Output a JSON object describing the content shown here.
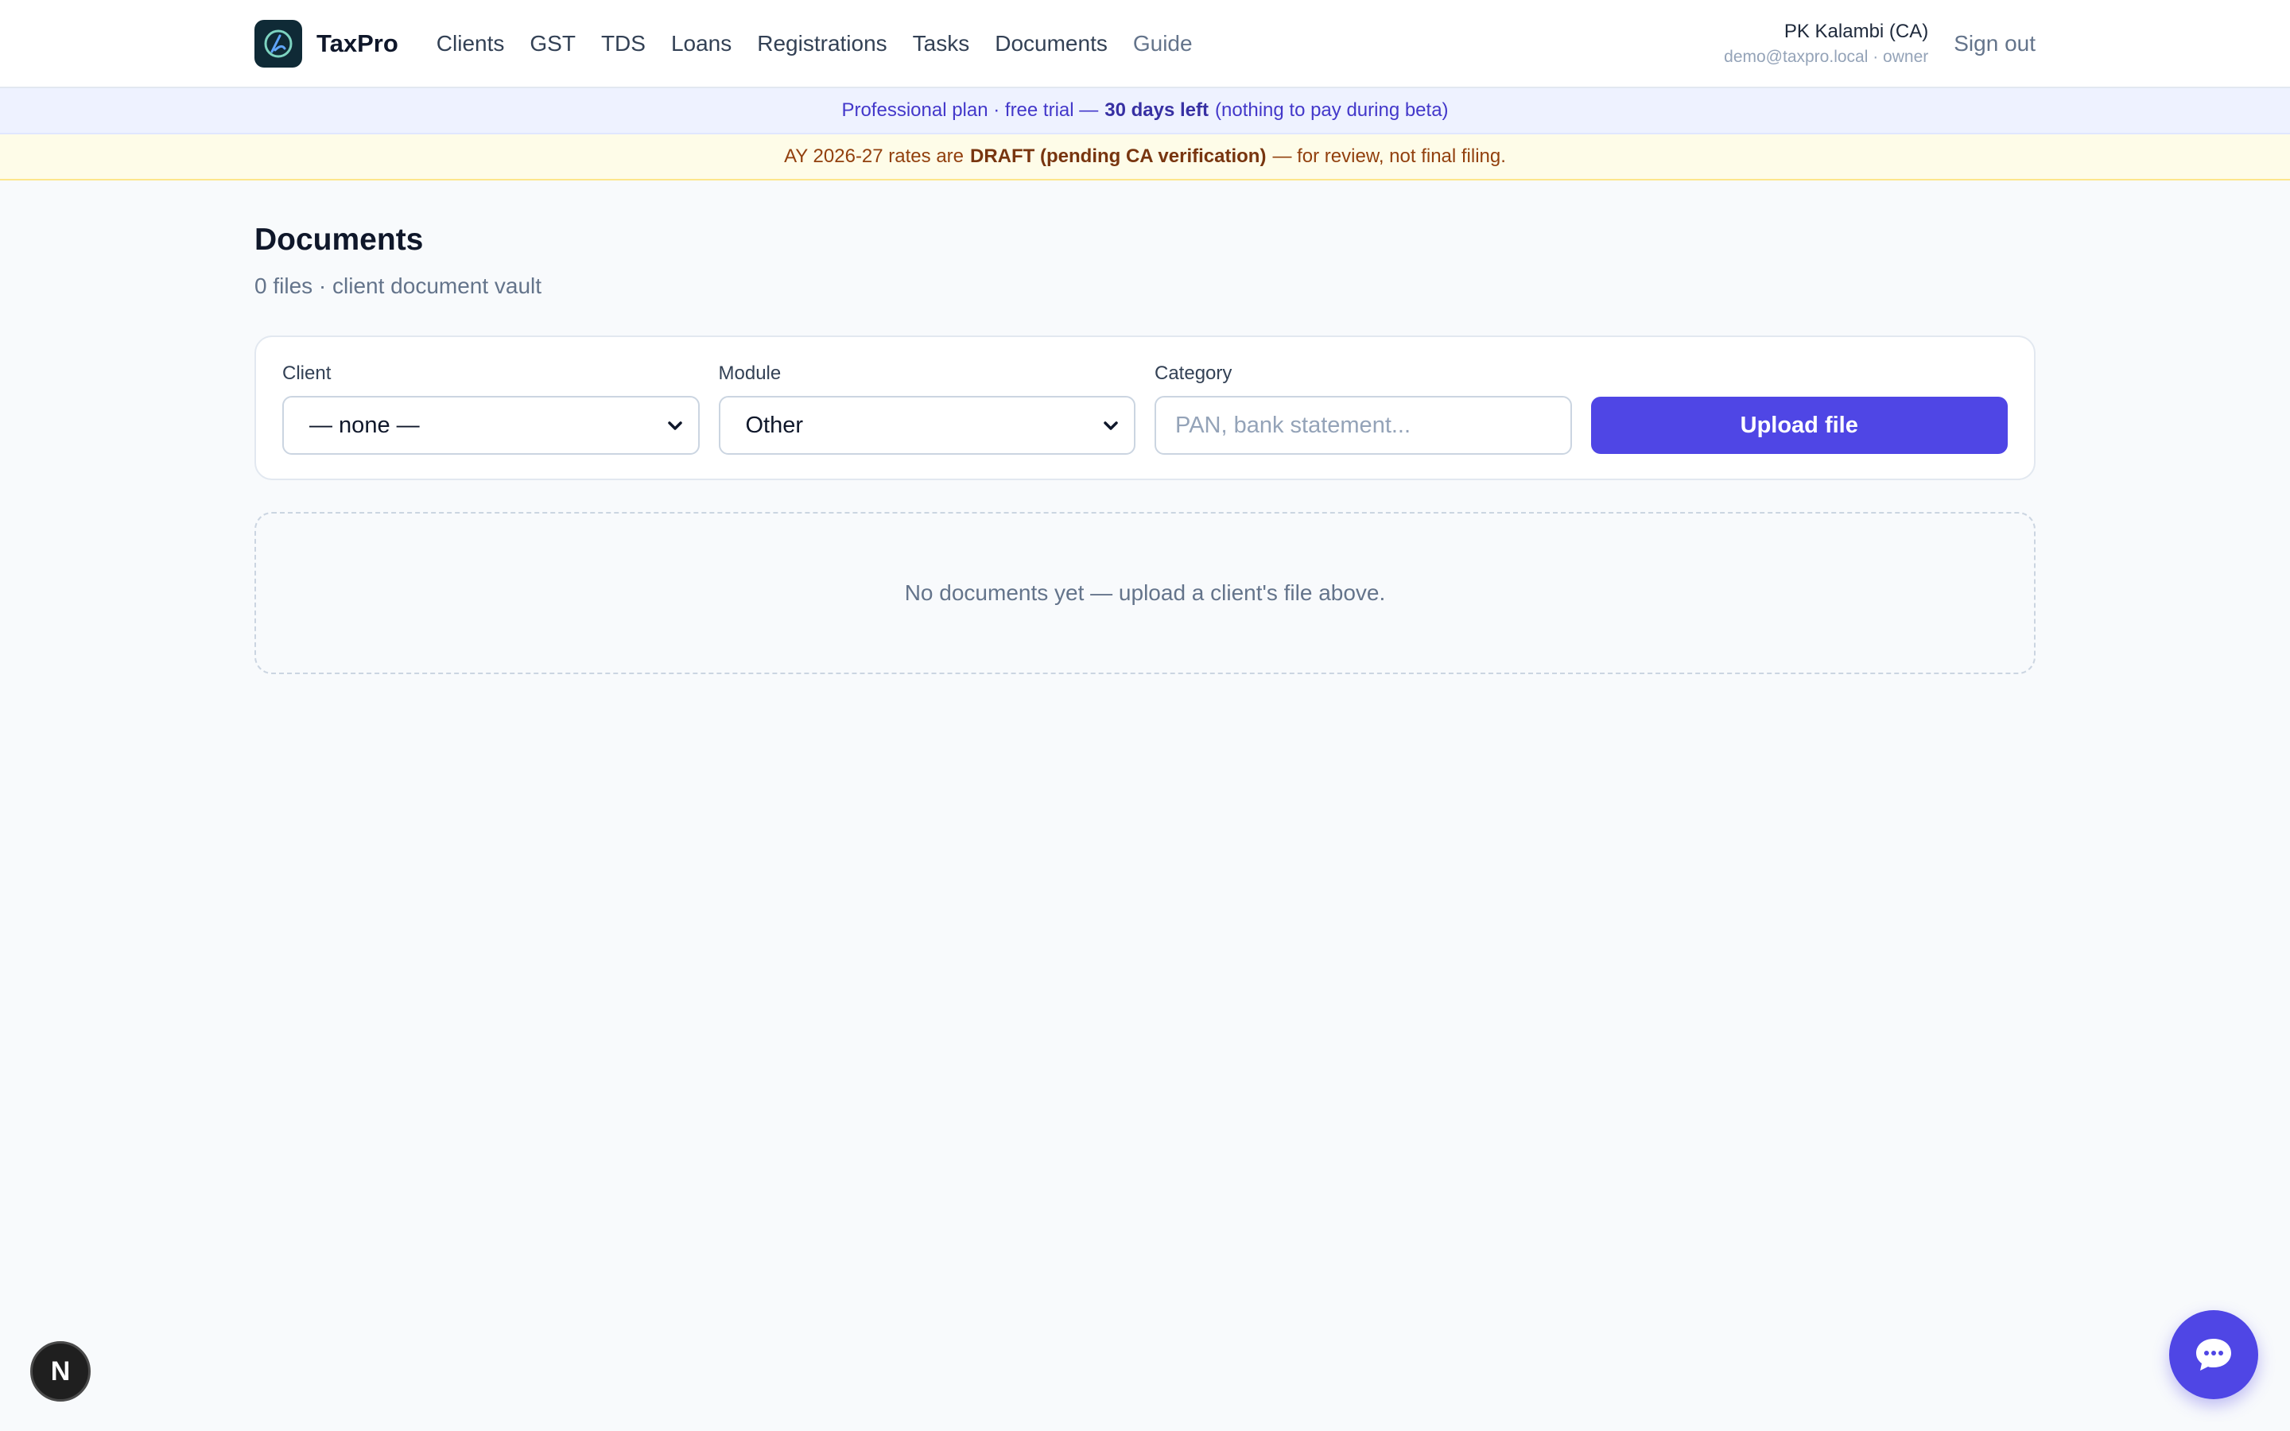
{
  "header": {
    "brand": "TaxPro",
    "nav": [
      "Clients",
      "GST",
      "TDS",
      "Loans",
      "Registrations",
      "Tasks",
      "Documents",
      "Guide"
    ],
    "user_name": "PK Kalambi (CA)",
    "user_email": "demo@taxpro.local · owner",
    "sign_out": "Sign out"
  },
  "plan_banner": {
    "prefix": "Professional plan · free trial —",
    "highlight": "30 days left",
    "suffix": "(nothing to pay during beta)"
  },
  "draft_banner": {
    "prefix": "AY 2026-27 rates are",
    "highlight": "DRAFT (pending CA verification)",
    "suffix": "— for review, not final filing."
  },
  "page": {
    "title": "Documents",
    "subtitle": "0 files · client document vault"
  },
  "upload": {
    "client_label": "Client",
    "client_value": "— none —",
    "module_label": "Module",
    "module_value": "Other",
    "category_label": "Category",
    "category_placeholder": "PAN, bank statement...",
    "button": "Upload file"
  },
  "empty_state": "No documents yet — upload a client's file above.",
  "badge_letter": "N",
  "colors": {
    "accent": "#4f46e5",
    "plan_banner_bg": "#eef2ff",
    "draft_banner_bg": "#fefce8"
  }
}
